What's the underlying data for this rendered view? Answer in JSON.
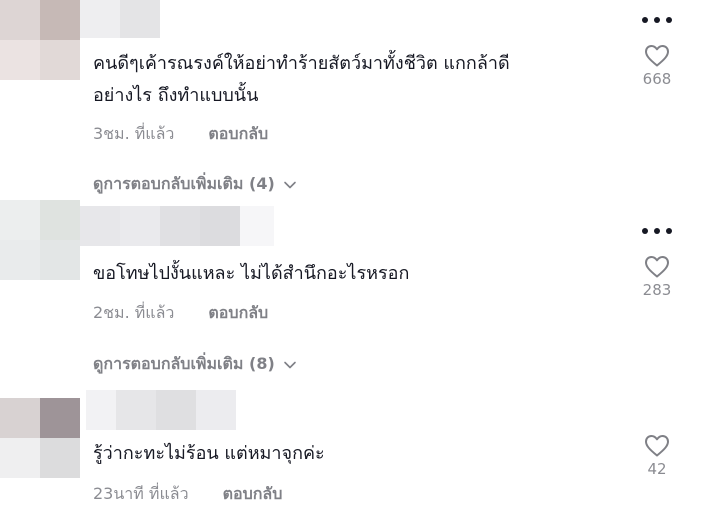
{
  "colors": {
    "text": "#161823",
    "secondary": "rgba(22,24,35,0.5)"
  },
  "comments": [
    {
      "text_line1": "คนดีๆเค้ารณรงค์ให้อย่าทำร้ายสัตว์มาทั้งชีวิต แกกล้าดี",
      "text_line2": "อย่างไร ถึงทำแบบนั้น",
      "time": "3ชม. ที่แล้ว",
      "reply_label": "ตอบกลับ",
      "likes": "668",
      "view_replies": "ดูการตอบกลับเพิ่มเติม (4)"
    },
    {
      "text_line1": "ขอโทษไปงั้นแหละ ไม่ได้สำนึกอะไรหรอก",
      "time": "2ชม. ที่แล้ว",
      "reply_label": "ตอบกลับ",
      "likes": "283",
      "view_replies": "ดูการตอบกลับเพิ่มเติม (8)"
    },
    {
      "text_line1": "รู้ว่ากะทะไม่ร้อน แต่หมาจุกค่ะ",
      "time": "23นาที ที่แล้ว",
      "reply_label": "ตอบกลับ",
      "likes": "42"
    }
  ],
  "icons": {
    "more": "more-horizontal-icon",
    "like": "heart-outline-icon",
    "expand": "chevron-down-icon"
  }
}
